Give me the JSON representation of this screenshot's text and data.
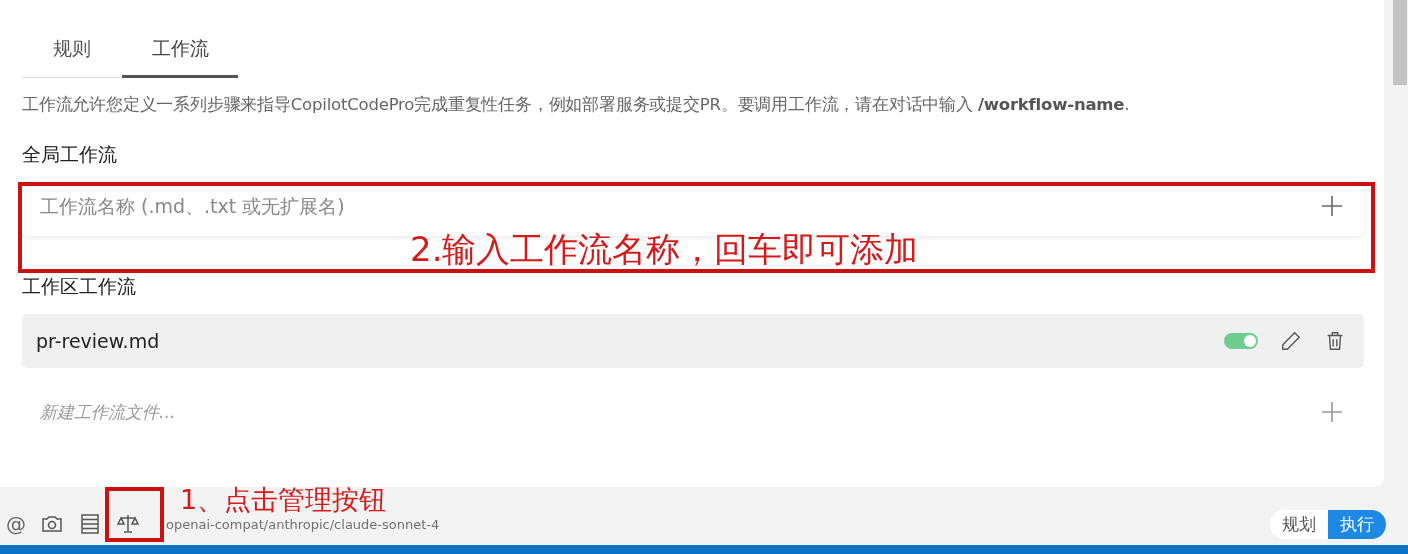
{
  "tabs": [
    {
      "label": "规则",
      "selected": false
    },
    {
      "label": "工作流",
      "selected": true
    }
  ],
  "description": "工作流允许您定义一系列步骤来指导CopilotCodePro完成重复性任务，例如部署服务或提交PR。要调用工作流，请在对话中输入 **/workflow-name**.",
  "global_section": {
    "heading": "全局工作流",
    "input": {
      "placeholder": "工作流名称 (.md、.txt 或无扩展名)"
    }
  },
  "workspace_section": {
    "heading": "工作区工作流",
    "workflows": [
      {
        "name": "pr-review.md",
        "enabled": true
      }
    ],
    "new_file": {
      "placeholder": "新建工作流文件..."
    }
  },
  "toolbar": {
    "mention": "@",
    "model": "openai-compat/anthropic/claude-sonnet-4",
    "modes": [
      {
        "label": "规划",
        "selected": false
      },
      {
        "label": "执行",
        "selected": true
      }
    ]
  },
  "annotations": [
    {
      "text": "2.输入工作流名称，回车即可添加"
    },
    {
      "text": "1、点击管理按钮"
    }
  ]
}
